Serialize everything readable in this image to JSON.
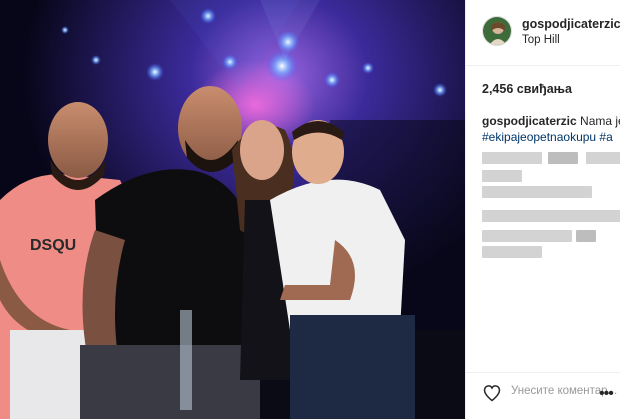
{
  "post": {
    "username": "gospodjicaterzic",
    "location": "Top Hill",
    "likes": "2,456 свиђања",
    "caption_user": "gospodjicaterzic",
    "caption_text": " Nama je",
    "hashtags": "#ekipajeopetnaokupu #a",
    "comment_placeholder": "Унесите коментар...",
    "more_options": "•••",
    "photo_shirt_text": "DSQU"
  },
  "colors": {
    "link": "#003569",
    "text": "#262626",
    "border": "#efefef"
  },
  "icons": [
    "heart-icon",
    "more-options-icon"
  ]
}
